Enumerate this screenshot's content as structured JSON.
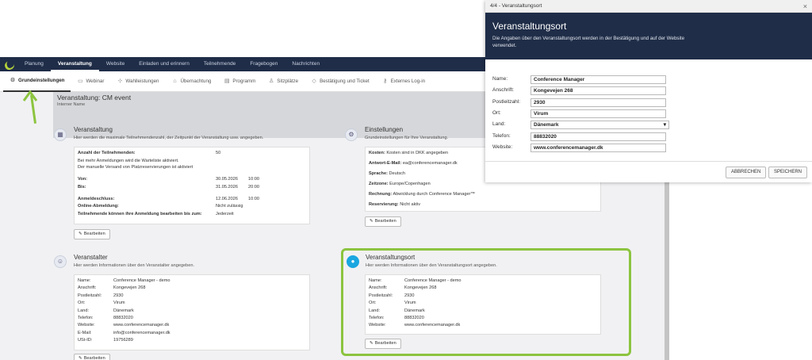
{
  "topnav": {
    "items": [
      "Planung",
      "Veranstaltung",
      "Website",
      "Einladen und erinnern",
      "Teilnehmende",
      "Fragebogen",
      "Nachrichten"
    ]
  },
  "subtabs": [
    {
      "label": "Grundeinstellungen",
      "icon": "gear-icon"
    },
    {
      "label": "Webinar",
      "icon": "video-icon"
    },
    {
      "label": "Wahlleistungen",
      "icon": "options-icon"
    },
    {
      "label": "Übernachtung",
      "icon": "bed-icon"
    },
    {
      "label": "Programm",
      "icon": "calendar-icon"
    },
    {
      "label": "Sitzplätze",
      "icon": "seat-icon"
    },
    {
      "label": "Bestätigung und Ticket",
      "icon": "ticket-icon"
    },
    {
      "label": "Externes Log-in",
      "icon": "key-icon"
    }
  ],
  "event": {
    "title": "Veranstaltung: CM event",
    "subtitle": "Interner Name"
  },
  "edit_label": "Bearbeiten",
  "veranstaltung": {
    "title": "Veranstaltung",
    "desc": "Hier werden die maximale Teilnehmendenzahl, der Zeitpunkt der Veranstaltung usw. angegeben.",
    "anzahl_label": "Anzahl der Teilnehmenden:",
    "anzahl_value": "50",
    "note1": "Bei mehr Anmeldungen wird die Warteliste aktiviert.",
    "note2": "Der manuelle Versand von Platzreservierungen ist aktiviert",
    "von_label": "Von:",
    "von_date": "30.05.2026",
    "von_time": "10:00",
    "bis_label": "Bis:",
    "bis_date": "31.05.2026",
    "bis_time": "20:00",
    "anmeldeschluss_label": "Anmeldeschluss:",
    "anmeldeschluss_date": "12.06.2026",
    "anmeldeschluss_time": "10:00",
    "online_label": "Online-Abmeldung:",
    "online_value": "Nicht zulässig",
    "bearbeiten_label": "Teilnehmende können ihre Anmeldung bearbeiten bis zum:",
    "bearbeiten_value": "Jederzeit"
  },
  "einstellungen": {
    "title": "Einstellungen",
    "desc": "Grundeinstellungen für Ihre Veranstaltung.",
    "kosten_label": "Kosten:",
    "kosten_value": "Kosten sind in DKK angegeben",
    "email_label": "Antwort-E-Mail:",
    "email_value": "ea@conferencemanager.dk",
    "sprache_label": "Sprache:",
    "sprache_value": "Deutsch",
    "zeitzone_label": "Zeitzone:",
    "zeitzone_value": "Europe/Copenhagen",
    "rechnung_label": "Rechnung:",
    "rechnung_value": "Abwicklung durch Conference Manager™",
    "reservierung_label": "Reservierung:",
    "reservierung_value": "Nicht aktiv"
  },
  "veranstalter": {
    "title": "Veranstalter",
    "desc": "Hier werden Informationen über den Veranstalter angegeben.",
    "rows": [
      {
        "label": "Name:",
        "value": "Conference Manager - demo"
      },
      {
        "label": "Anschrift:",
        "value": "Kongevejen 268"
      },
      {
        "label": "Postleitzahl:",
        "value": "2930"
      },
      {
        "label": "Ort:",
        "value": "Virum"
      },
      {
        "label": "Land:",
        "value": "Dänemark"
      },
      {
        "label": "Telefon:",
        "value": "88832020"
      },
      {
        "label": "Website:",
        "value": "www.conferencemanager.dk"
      },
      {
        "label": "E-Mail:",
        "value": "info@conferencemanager.dk"
      },
      {
        "label": "USt-ID:",
        "value": "19756289"
      }
    ]
  },
  "veranstaltungsort": {
    "title": "Veranstaltungsort",
    "desc": "Hier werden Informationen über den Veranstaltungsort angegeben.",
    "rows": [
      {
        "label": "Name:",
        "value": "Conference Manager - demo"
      },
      {
        "label": "Anschrift:",
        "value": "Kongevejen 268"
      },
      {
        "label": "Postleitzahl:",
        "value": "2930"
      },
      {
        "label": "Ort:",
        "value": "Virum"
      },
      {
        "label": "Land:",
        "value": "Dänemark"
      },
      {
        "label": "Telefon:",
        "value": "88832020"
      },
      {
        "label": "Website:",
        "value": "www.conferencemanager.dk"
      }
    ]
  },
  "modal": {
    "window_title": "4/4 - Veranstaltungsort",
    "close": "×",
    "heading": "Veranstaltungsort",
    "description": "Die Angaben über den Veranstaltungsort werden in der Bestätigung und auf der Website verwendet.",
    "fields": [
      {
        "label": "Name:",
        "value": "Conference Manager"
      },
      {
        "label": "Anschrift:",
        "value": "Kongevejen 268"
      },
      {
        "label": "Postleitzahl:",
        "value": "2930"
      },
      {
        "label": "Ort:",
        "value": "Virum"
      },
      {
        "label": "Land:",
        "value": "Dänemark"
      },
      {
        "label": "Telefon:",
        "value": "88832020"
      },
      {
        "label": "Website:",
        "value": "www.conferencemanager.dk"
      }
    ],
    "cancel": "ABBRECHEN",
    "save": "SPEICHERN"
  },
  "colors": {
    "navy": "#1f2d48",
    "accent_green": "#8cc43f"
  }
}
